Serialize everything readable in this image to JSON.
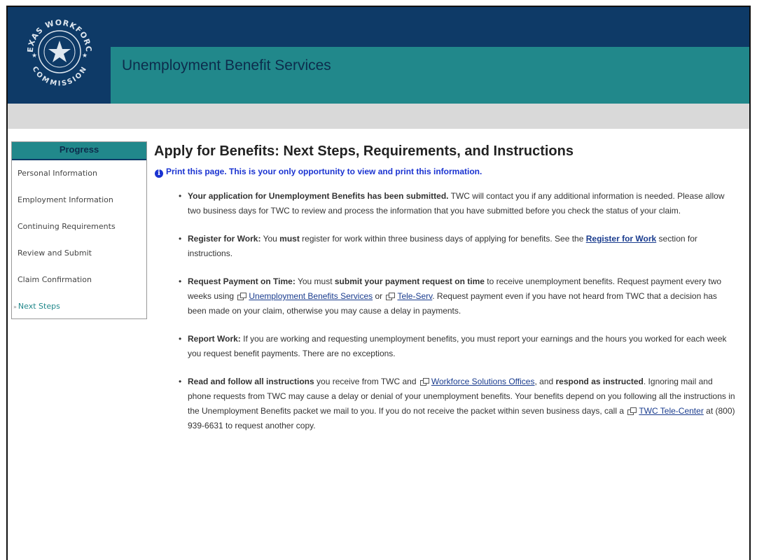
{
  "header": {
    "app_title": "Unemployment Benefit Services",
    "seal_text_top": "TEXAS WORKFORCE",
    "seal_text_bottom": "COMMISSION",
    "colors": {
      "navy": "#0e3a67",
      "teal": "#21888b",
      "grey_bar": "#d9d9d9"
    }
  },
  "sidebar": {
    "title": "Progress",
    "items": [
      {
        "label": "Personal Information"
      },
      {
        "label": "Employment Information"
      },
      {
        "label": "Continuing Requirements"
      },
      {
        "label": "Review and Submit"
      },
      {
        "label": "Claim Confirmation"
      },
      {
        "label": "Next Steps",
        "active": true
      }
    ]
  },
  "main": {
    "title": "Apply for Benefits: Next Steps, Requirements, and Instructions",
    "notice": "Print this page. This is your only opportunity to view and print this information.",
    "steps": [
      {
        "bold": "Your application for Unemployment Benefits has been submitted.",
        "text": " TWC will contact you if any additional information is needed. Please allow two business days for TWC to review and process the information that you have submitted before you check the status of your claim."
      },
      {
        "bold": "Register for Work:",
        "text_a": "  You ",
        "must": "must",
        "text_b": " register for work within three business days of applying for benefits. See the ",
        "link": "Register for Work",
        "text_c": " section for instructions."
      },
      {
        "bold": "Request Payment on Time:",
        "text_a": "  You must ",
        "bold_b": "submit your payment request on time",
        "text_b": " to receive unemployment benefits. Request payment every two weeks using ",
        "link_a": "Unemployment Benefits Services",
        "text_c": " or ",
        "link_b": "Tele-Serv",
        "text_d": ". Request payment even if you have not heard from TWC that a decision has been made on your claim, otherwise you may cause a delay in payments."
      },
      {
        "bold": "Report Work:",
        "text": "  If you are working and requesting unemployment benefits, you must report your earnings and the hours you worked for each week you request benefit payments. There are no exceptions."
      },
      {
        "bold": "Read and follow all instructions",
        "text_a": " you receive from TWC and ",
        "link_a": "Workforce Solutions Offices",
        "text_b": ", and ",
        "bold_b": "respond as instructed",
        "text_c": ". Ignoring mail and phone requests from TWC may cause a delay or denial of your unemployment benefits. Your benefits depend on you following all the instructions in the Unemployment Benefits packet we mail to you. If you do not receive the packet within seven business days, call a ",
        "link_b": "TWC Tele-Center",
        "text_d": " at (800) 939-6631 to request another copy."
      }
    ]
  }
}
